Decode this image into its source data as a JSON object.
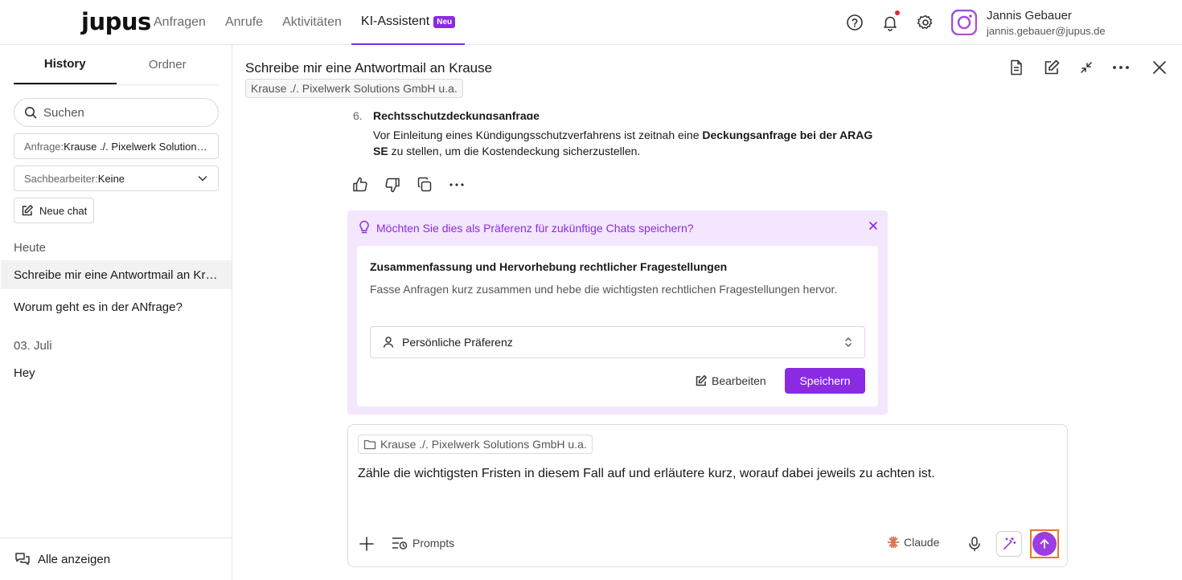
{
  "app": {
    "logo": "jupus"
  },
  "nav": [
    {
      "label": "Anfragen"
    },
    {
      "label": "Anrufe"
    },
    {
      "label": "Aktivitäten"
    },
    {
      "label": "KI-Assistent",
      "badge": "Neu",
      "active": true
    }
  ],
  "user": {
    "name": "Jannis Gebauer",
    "email": "jannis.gebauer@jupus.de"
  },
  "sidebar": {
    "tabs": [
      {
        "label": "History"
      },
      {
        "label": "Ordner"
      }
    ],
    "search_placeholder": "Suchen",
    "filter_anfrage": {
      "label": "Anfrage:",
      "value": "Krause ./. Pixelwerk Solutions..."
    },
    "filter_sachbearbeiter": {
      "label": "Sachbearbeiter:",
      "value": "Keine"
    },
    "new_chat": "Neue chat",
    "today_label": "Heute",
    "today_items": [
      "Schreibe mir eine Antwortmail an Krause",
      "Worum geht es in der ANfrage?"
    ],
    "date_label": "03. Juli",
    "date_items": [
      "Hey"
    ],
    "show_all": "Alle anzeigen"
  },
  "chat": {
    "title": "Schreibe mir eine Antwortmail an Krause",
    "case_tag": "Krause ./. Pixelwerk Solutions GmbH u.a."
  },
  "message": {
    "number": "6.",
    "heading": "Rechtsschutzdeckungsanfrage",
    "body_1": "Vor Einleitung eines Kündigungsschutzverfahrens ist zeitnah eine ",
    "body_bold": "Deckungsanfrage bei der ARAG SE",
    "body_2": " zu stellen, um die Kostendeckung sicherzustellen."
  },
  "preference": {
    "question": "Möchten Sie dies als Präferenz für zukünftige Chats speichern?",
    "title": "Zusammenfassung und Hervorhebung rechtlicher Fragestellungen",
    "description": "Fasse Anfragen kurz zusammen und hebe die wichtigsten rechtlichen Fragestellungen hervor.",
    "scope": "Persönliche Präferenz",
    "edit_label": "Bearbeiten",
    "save_label": "Speichern",
    "accent": "#8a2be2"
  },
  "composer": {
    "case_tag": "Krause ./. Pixelwerk Solutions GmbH u.a.",
    "text": "Zähle die wichtigsten Fristen in diesem Fall auf und erläutere kurz, worauf dabei jeweils zu achten ist.",
    "prompts_label": "Prompts",
    "model_label": "Claude"
  }
}
